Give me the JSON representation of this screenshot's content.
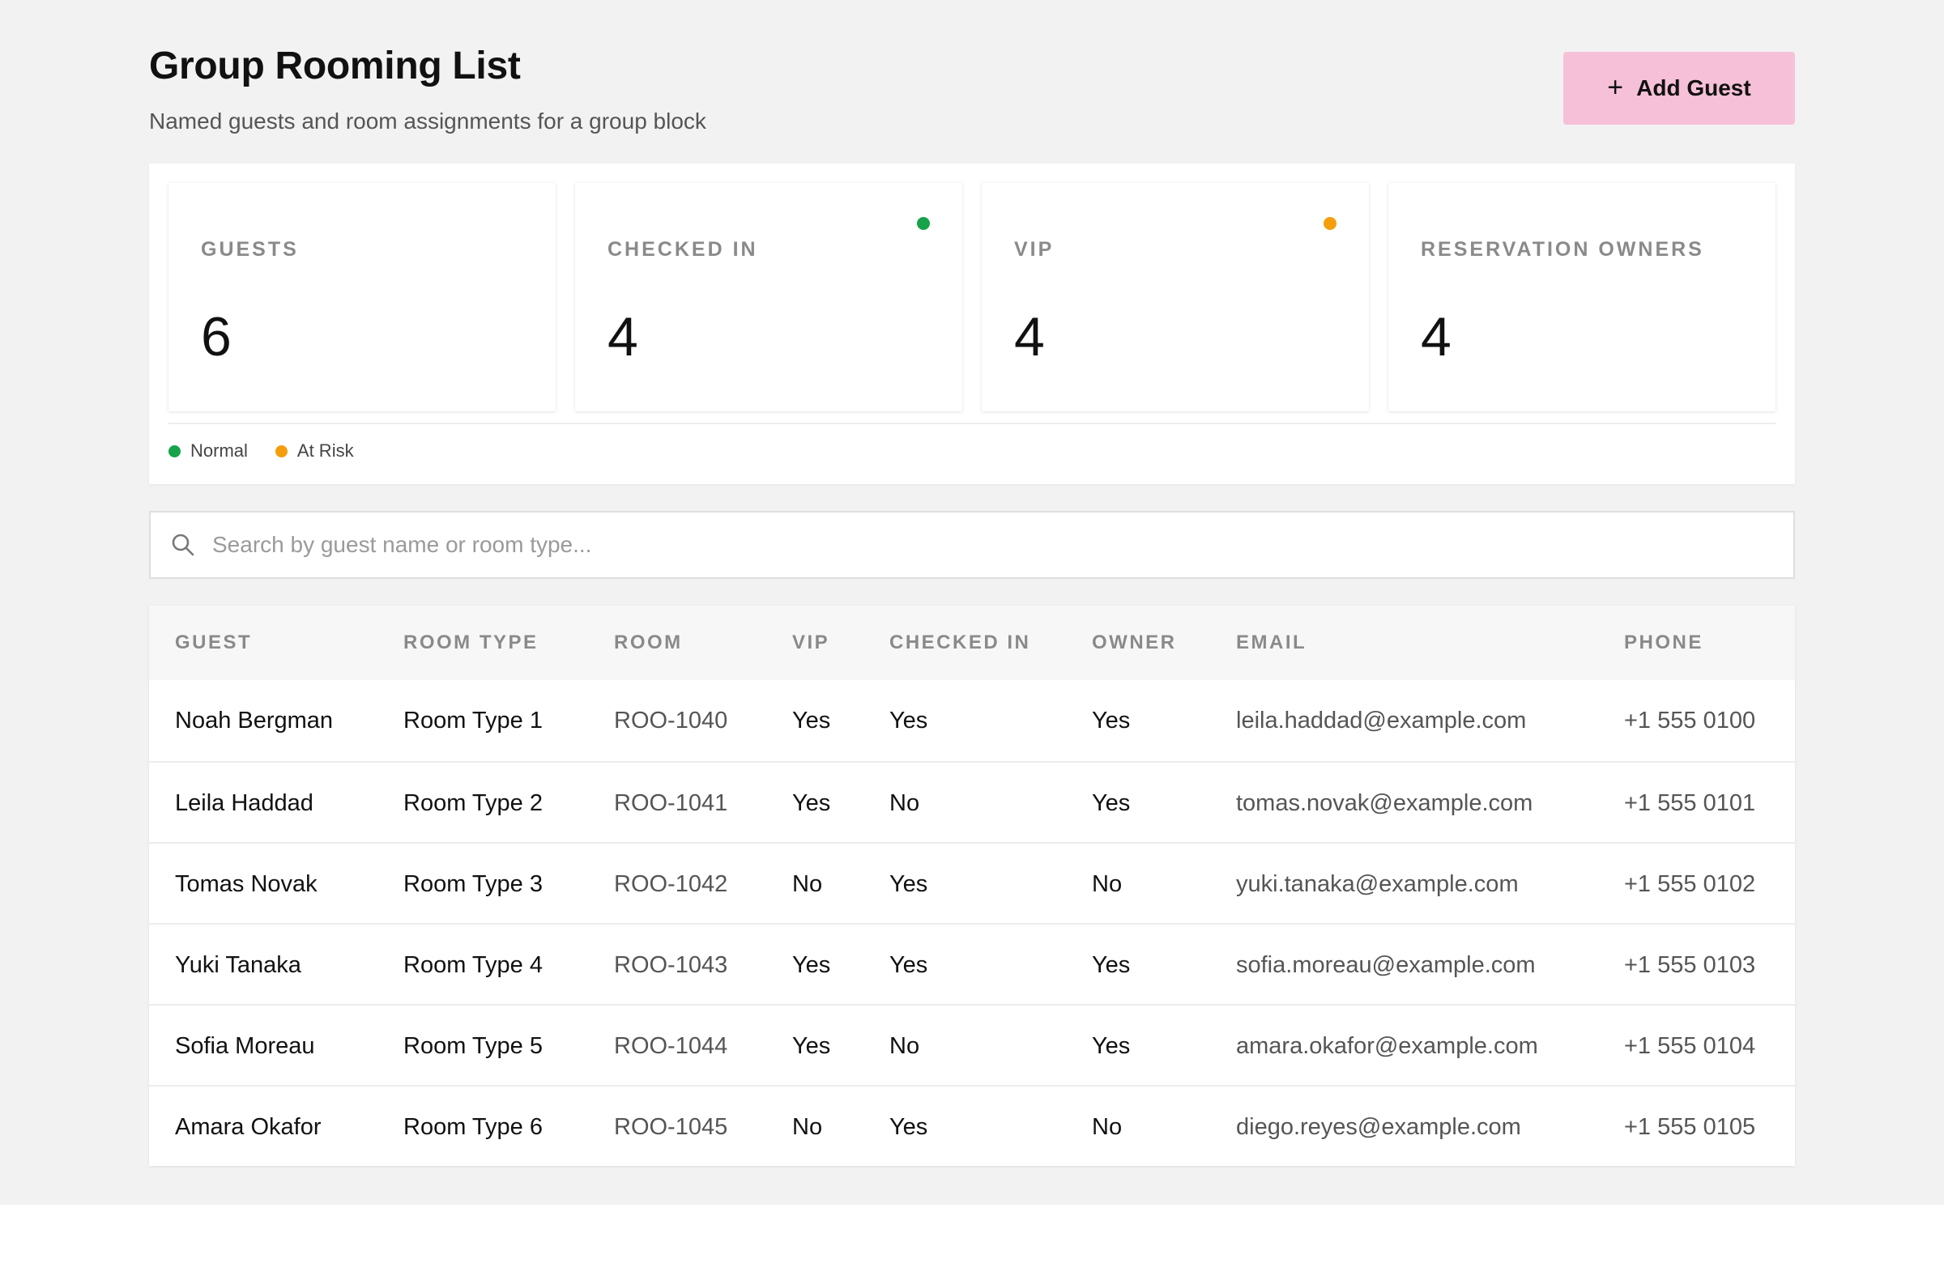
{
  "header": {
    "title": "Group Rooming List",
    "subtitle": "Named guests and room assignments for a group block",
    "add_button_icon": "+",
    "add_button_label": "Add Guest"
  },
  "colors": {
    "accent_button": "#f6c1d8",
    "status_normal": "#16a34a",
    "status_at_risk": "#f59e0b"
  },
  "stats": [
    {
      "label": "GUESTS",
      "value": "6",
      "indicator": null
    },
    {
      "label": "CHECKED IN",
      "value": "4",
      "indicator": "normal"
    },
    {
      "label": "VIP",
      "value": "4",
      "indicator": "at_risk"
    },
    {
      "label": "RESERVATION OWNERS",
      "value": "4",
      "indicator": null
    }
  ],
  "legend": [
    {
      "label": "Normal",
      "status": "normal"
    },
    {
      "label": "At Risk",
      "status": "at_risk"
    }
  ],
  "search": {
    "icon": "search-icon",
    "placeholder": "Search by guest name or room type..."
  },
  "table": {
    "columns": [
      "GUEST",
      "ROOM TYPE",
      "ROOM",
      "VIP",
      "CHECKED IN",
      "OWNER",
      "EMAIL",
      "PHONE"
    ],
    "rows": [
      [
        "Noah Bergman",
        "Room Type 1",
        "ROO-1040",
        "Yes",
        "Yes",
        "Yes",
        "leila.haddad@example.com",
        "+1 555 0100"
      ],
      [
        "Leila Haddad",
        "Room Type 2",
        "ROO-1041",
        "Yes",
        "No",
        "Yes",
        "tomas.novak@example.com",
        "+1 555 0101"
      ],
      [
        "Tomas Novak",
        "Room Type 3",
        "ROO-1042",
        "No",
        "Yes",
        "No",
        "yuki.tanaka@example.com",
        "+1 555 0102"
      ],
      [
        "Yuki Tanaka",
        "Room Type 4",
        "ROO-1043",
        "Yes",
        "Yes",
        "Yes",
        "sofia.moreau@example.com",
        "+1 555 0103"
      ],
      [
        "Sofia Moreau",
        "Room Type 5",
        "ROO-1044",
        "Yes",
        "No",
        "Yes",
        "amara.okafor@example.com",
        "+1 555 0104"
      ],
      [
        "Amara Okafor",
        "Room Type 6",
        "ROO-1045",
        "No",
        "Yes",
        "No",
        "diego.reyes@example.com",
        "+1 555 0105"
      ]
    ]
  }
}
